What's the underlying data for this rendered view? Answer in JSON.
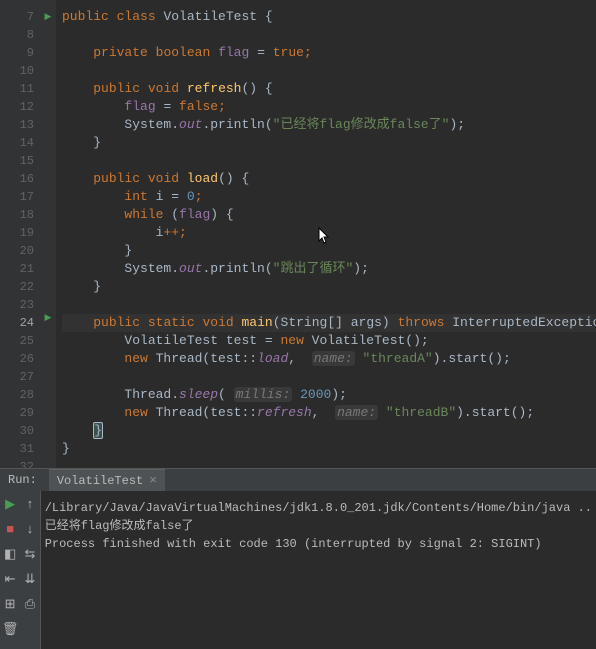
{
  "lines": [
    7,
    8,
    9,
    10,
    11,
    12,
    13,
    14,
    15,
    16,
    17,
    18,
    19,
    20,
    21,
    22,
    23,
    24,
    25,
    26,
    27,
    28,
    29,
    30,
    31,
    32
  ],
  "current_line": 24,
  "code": {
    "class_decl": {
      "kw_public": "public",
      "kw_class": "class",
      "name": "VolatileTest",
      "brace": "{"
    },
    "field": {
      "kw_private": "private",
      "kw_boolean": "boolean",
      "name": "flag",
      "eq": "=",
      "val": "true",
      "semi": ";"
    },
    "refresh": {
      "kw_public": "public",
      "kw_void": "void",
      "name": "refresh",
      "sig": "() {",
      "l1_flag": "flag",
      "l1_eq": " = ",
      "l1_val": "false",
      "l1_semi": ";",
      "l2_sys": "System.",
      "l2_out": "out",
      "l2_pr": ".println(",
      "l2_str": "\"已经将flag修改成false了\"",
      "l2_end": ");",
      "close": "}"
    },
    "load": {
      "kw_public": "public",
      "kw_void": "void",
      "name": "load",
      "sig": "() {",
      "l1_int": "int",
      "l1_i": "i",
      "l1_eq": "=",
      "l1_zero": "0",
      "l1_semi": ";",
      "l2_while": "while",
      "l2_open": "(",
      "l2_flag": "flag",
      "l2_close": ") {",
      "l3_i": "i",
      "l3_pp": "++;",
      "l4_close": "}",
      "l5_sys": "System.",
      "l5_out": "out",
      "l5_pr": ".println(",
      "l5_str": "\"跳出了循环\"",
      "l5_end": ");",
      "close": "}"
    },
    "main": {
      "kw_public": "public",
      "kw_static": "static",
      "kw_void": "void",
      "name": "main",
      "args": "(String[] args)",
      "kw_throws": "throws",
      "exc": "InterruptedException",
      "brace": "{",
      "l1_cls": "VolatileTest ",
      "l1_var": "test",
      "l1_eq": " = ",
      "l1_new": "new",
      "l1_ctor": " VolatileTest();",
      "l2_new": "new",
      "l2_thr": " Thread(test::",
      "l2_ref": "load",
      "l2_c": ", ",
      "l2_hint": "name:",
      "l2_str": "\"threadA\"",
      "l2_end": ").start();",
      "l3_sleep": "Thread.",
      "l3_sl": "sleep",
      "l3_open": "(",
      "l3_hint": "millis:",
      "l3_ms": "2000",
      "l3_end": ");",
      "l4_new": "new",
      "l4_thr": " Thread(test::",
      "l4_ref": "refresh",
      "l4_c": ", ",
      "l4_hint": "name:",
      "l4_str": "\"threadB\"",
      "l4_end": ").start();",
      "close": "}"
    },
    "class_close": "}"
  },
  "run": {
    "label": "Run:",
    "tab": "VolatileTest",
    "line1": "/Library/Java/JavaVirtualMachines/jdk1.8.0_201.jdk/Contents/Home/bin/java ..",
    "line2": "已经将flag修改成false了",
    "line3": "Process finished with exit code 130 (interrupted by signal 2: SIGINT)"
  }
}
